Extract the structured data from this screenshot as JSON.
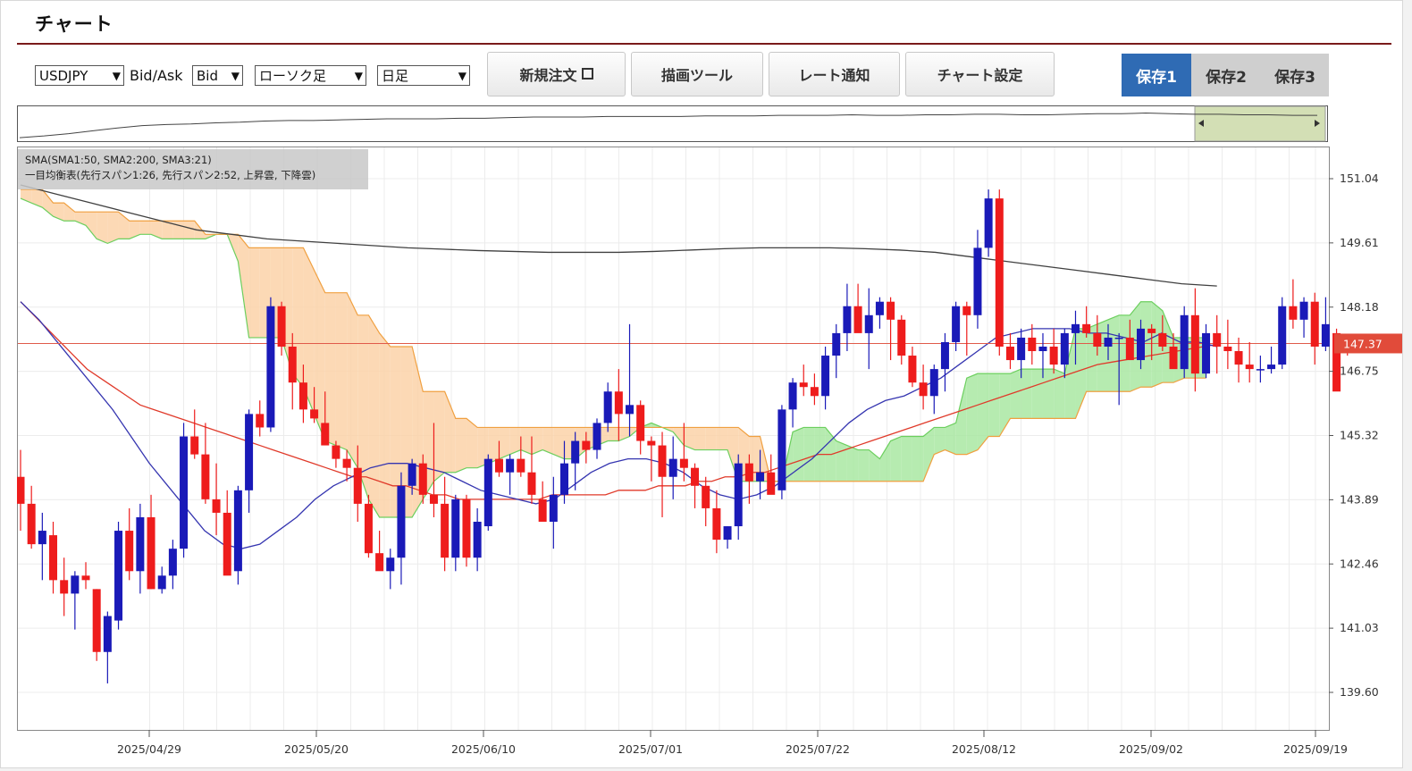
{
  "page": {
    "title": "チャート"
  },
  "toolbar": {
    "symbol": "USDJPY",
    "bidask_label": "Bid/Ask",
    "bidask_value": "Bid",
    "chart_type": "ローソク足",
    "period": "日足",
    "new_order": "新規注文",
    "drawing_tools": "描画ツール",
    "rate_alert": "レート通知",
    "chart_settings": "チャート設定",
    "saves": [
      "保存1",
      "保存2",
      "保存3"
    ],
    "active_save": 0
  },
  "colors": {
    "up": "#1a1ab8",
    "down": "#ee1c1c",
    "sma50": "#e03a2a",
    "sma200": "#404040",
    "sma21": "#3535b0",
    "cloud_up": "#a9e7a2",
    "cloud_down": "#fcd2a8",
    "span1": "#6ccf5e",
    "span2": "#f0a040",
    "price_line": "#e05a4a",
    "price_badge": "#e14b3a",
    "active_save": "#2f6bb4"
  },
  "chart_data": {
    "type": "candlestick",
    "symbol": "USDJPY",
    "timeframe": "日足",
    "legend": [
      "SMA(SMA1:50, SMA2:200, SMA3:21)",
      "一目均衡表(先行スパン1:26, 先行スパン2:52, 上昇雲, 下降雲)"
    ],
    "y_ticks": [
      "151.04",
      "149.61",
      "148.18",
      "146.75",
      "145.32",
      "143.89",
      "142.46",
      "141.03",
      "139.60"
    ],
    "ylim": [
      139.1,
      151.8
    ],
    "x_ticks": [
      "2025/04/29",
      "2025/05/20",
      "2025/06/10",
      "2025/07/01",
      "2025/07/22",
      "2025/08/12",
      "2025/09/02",
      "2025/09/19"
    ],
    "current_price": "147.37",
    "candles": [
      [
        144.4,
        145.0,
        143.2,
        143.8
      ],
      [
        143.8,
        144.2,
        142.8,
        142.9
      ],
      [
        142.9,
        143.6,
        142.1,
        143.2
      ],
      [
        143.1,
        143.4,
        141.8,
        142.1
      ],
      [
        142.1,
        142.6,
        141.3,
        141.8
      ],
      [
        141.8,
        142.3,
        141.0,
        142.2
      ],
      [
        142.2,
        142.5,
        141.9,
        142.1
      ],
      [
        141.9,
        141.9,
        140.3,
        140.5
      ],
      [
        140.5,
        141.4,
        139.8,
        141.3
      ],
      [
        141.2,
        143.4,
        141.0,
        143.2
      ],
      [
        143.2,
        143.7,
        142.1,
        142.3
      ],
      [
        142.3,
        143.8,
        141.8,
        143.5
      ],
      [
        143.5,
        144.0,
        141.9,
        141.9
      ],
      [
        141.9,
        142.4,
        141.8,
        142.2
      ],
      [
        142.2,
        143.0,
        141.9,
        142.8
      ],
      [
        142.8,
        145.6,
        142.6,
        145.3
      ],
      [
        145.3,
        145.9,
        144.8,
        144.9
      ],
      [
        144.9,
        145.6,
        143.8,
        143.9
      ],
      [
        143.9,
        144.7,
        143.1,
        143.6
      ],
      [
        143.6,
        144.1,
        142.3,
        142.2
      ],
      [
        142.3,
        144.2,
        142.0,
        144.1
      ],
      [
        144.1,
        145.9,
        143.6,
        145.8
      ],
      [
        145.8,
        146.1,
        145.3,
        145.5
      ],
      [
        145.5,
        148.4,
        145.4,
        148.2
      ],
      [
        148.2,
        148.3,
        147.1,
        147.3
      ],
      [
        147.3,
        147.6,
        145.9,
        146.5
      ],
      [
        146.5,
        146.9,
        145.6,
        145.9
      ],
      [
        145.9,
        146.4,
        145.6,
        145.7
      ],
      [
        145.6,
        146.3,
        145.3,
        145.1
      ],
      [
        145.1,
        145.2,
        144.6,
        144.8
      ],
      [
        144.8,
        145.0,
        144.3,
        144.6
      ],
      [
        144.6,
        145.1,
        143.4,
        143.8
      ],
      [
        143.8,
        144.0,
        142.6,
        142.7
      ],
      [
        142.7,
        143.2,
        142.4,
        142.3
      ],
      [
        142.3,
        142.8,
        141.9,
        142.6
      ],
      [
        142.6,
        144.5,
        142.0,
        144.2
      ],
      [
        144.2,
        144.8,
        144.0,
        144.7
      ],
      [
        144.7,
        144.9,
        143.8,
        144.0
      ],
      [
        144.0,
        145.6,
        143.5,
        143.8
      ],
      [
        143.8,
        144.4,
        142.3,
        142.6
      ],
      [
        142.6,
        144.0,
        142.3,
        143.9
      ],
      [
        143.9,
        144.0,
        142.4,
        142.6
      ],
      [
        142.6,
        143.7,
        142.3,
        143.4
      ],
      [
        143.3,
        144.9,
        143.2,
        144.8
      ],
      [
        144.8,
        145.2,
        144.4,
        144.5
      ],
      [
        144.5,
        144.9,
        144.0,
        144.8
      ],
      [
        144.8,
        145.3,
        144.4,
        144.5
      ],
      [
        144.5,
        145.3,
        143.8,
        144.0
      ],
      [
        143.9,
        144.3,
        143.5,
        143.4
      ],
      [
        143.4,
        144.4,
        142.8,
        144.0
      ],
      [
        144.0,
        145.2,
        143.8,
        144.7
      ],
      [
        144.7,
        145.4,
        144.1,
        145.2
      ],
      [
        145.2,
        145.4,
        144.7,
        145.0
      ],
      [
        145.0,
        145.7,
        144.8,
        145.6
      ],
      [
        145.6,
        146.5,
        145.4,
        146.3
      ],
      [
        146.3,
        146.8,
        145.2,
        145.8
      ],
      [
        145.8,
        147.8,
        145.3,
        146.0
      ],
      [
        146.0,
        146.1,
        144.9,
        145.2
      ],
      [
        145.2,
        145.3,
        144.3,
        145.1
      ],
      [
        145.1,
        145.4,
        143.5,
        144.4
      ],
      [
        144.4,
        145.3,
        143.9,
        144.8
      ],
      [
        144.8,
        145.6,
        144.3,
        144.6
      ],
      [
        144.6,
        144.7,
        143.7,
        144.2
      ],
      [
        144.2,
        144.4,
        143.3,
        143.7
      ],
      [
        143.7,
        144.1,
        142.7,
        143.0
      ],
      [
        143.0,
        143.3,
        142.8,
        143.3
      ],
      [
        143.3,
        144.9,
        143.0,
        144.7
      ],
      [
        144.7,
        144.9,
        143.8,
        144.3
      ],
      [
        144.3,
        145.0,
        143.9,
        144.5
      ],
      [
        144.5,
        144.9,
        144.1,
        144.0
      ],
      [
        144.1,
        146.0,
        143.9,
        145.9
      ],
      [
        145.9,
        146.6,
        145.5,
        146.5
      ],
      [
        146.5,
        146.9,
        146.2,
        146.4
      ],
      [
        146.4,
        146.7,
        146.0,
        146.2
      ],
      [
        146.2,
        147.3,
        145.9,
        147.1
      ],
      [
        147.1,
        147.8,
        146.6,
        147.6
      ],
      [
        147.6,
        148.7,
        147.2,
        148.2
      ],
      [
        148.2,
        148.7,
        147.8,
        147.6
      ],
      [
        147.6,
        148.6,
        146.8,
        148.0
      ],
      [
        148.0,
        148.4,
        147.7,
        148.3
      ],
      [
        148.3,
        148.4,
        147.0,
        147.9
      ],
      [
        147.9,
        148.0,
        146.9,
        147.1
      ],
      [
        147.1,
        147.3,
        146.4,
        146.5
      ],
      [
        146.5,
        146.9,
        145.9,
        146.2
      ],
      [
        146.2,
        146.9,
        145.8,
        146.8
      ],
      [
        146.8,
        147.6,
        146.3,
        147.4
      ],
      [
        147.4,
        148.3,
        147.2,
        148.2
      ],
      [
        148.2,
        148.3,
        147.1,
        148.0
      ],
      [
        148.0,
        149.9,
        147.7,
        149.5
      ],
      [
        149.5,
        150.8,
        149.3,
        150.6
      ],
      [
        150.6,
        150.8,
        147.1,
        147.3
      ],
      [
        147.3,
        147.6,
        146.8,
        147.0
      ],
      [
        147.0,
        147.7,
        146.6,
        147.5
      ],
      [
        147.5,
        147.8,
        146.9,
        147.2
      ],
      [
        147.2,
        147.6,
        146.6,
        147.3
      ],
      [
        147.3,
        147.7,
        146.7,
        146.9
      ],
      [
        146.9,
        147.7,
        146.6,
        147.6
      ],
      [
        147.6,
        148.1,
        146.9,
        147.8
      ],
      [
        147.8,
        148.2,
        147.5,
        147.6
      ],
      [
        147.6,
        148.0,
        147.1,
        147.3
      ],
      [
        147.3,
        147.8,
        147.0,
        147.5
      ],
      [
        147.5,
        147.6,
        146.0,
        147.5
      ],
      [
        147.5,
        147.9,
        147.0,
        147.0
      ],
      [
        147.0,
        147.9,
        146.8,
        147.7
      ],
      [
        147.7,
        147.8,
        147.0,
        147.6
      ],
      [
        147.6,
        148.0,
        147.2,
        147.3
      ],
      [
        147.3,
        147.6,
        146.9,
        146.8
      ],
      [
        146.8,
        148.2,
        146.6,
        148.0
      ],
      [
        148.0,
        148.6,
        146.3,
        146.7
      ],
      [
        146.7,
        147.8,
        146.6,
        147.6
      ],
      [
        147.6,
        148.0,
        146.7,
        147.3
      ],
      [
        147.3,
        147.9,
        146.8,
        147.2
      ],
      [
        147.2,
        147.5,
        146.5,
        146.9
      ],
      [
        146.9,
        147.4,
        146.5,
        146.8
      ],
      [
        146.8,
        147.1,
        146.5,
        146.8
      ],
      [
        146.8,
        147.3,
        146.7,
        146.9
      ],
      [
        146.9,
        148.4,
        146.8,
        148.2
      ],
      [
        148.2,
        148.8,
        147.7,
        147.9
      ],
      [
        147.9,
        148.4,
        147.5,
        148.3
      ],
      [
        148.3,
        148.5,
        146.9,
        147.3
      ],
      [
        147.3,
        148.4,
        147.2,
        147.8
      ],
      [
        147.6,
        147.7,
        146.5,
        146.3
      ],
      [
        147.4,
        147.5,
        147.1,
        147.3
      ]
    ],
    "sma50": [
      148.3,
      148.0,
      147.7,
      147.4,
      147.1,
      146.8,
      146.6,
      146.4,
      146.2,
      146.0,
      145.9,
      145.8,
      145.7,
      145.6,
      145.5,
      145.4,
      145.3,
      145.2,
      145.1,
      145.0,
      144.9,
      144.8,
      144.7,
      144.6,
      144.5,
      144.4,
      144.4,
      144.3,
      144.2,
      144.2,
      144.1,
      144.0,
      144.0,
      143.9,
      143.9,
      143.9,
      143.9,
      143.9,
      143.9,
      143.9,
      144.0,
      144.0,
      144.0,
      144.0,
      144.0,
      144.1,
      144.1,
      144.1,
      144.2,
      144.2,
      144.2,
      144.3,
      144.3,
      144.4,
      144.4,
      144.5,
      144.5,
      144.6,
      144.7,
      144.8,
      144.9,
      144.9,
      145.0,
      145.1,
      145.2,
      145.3,
      145.4,
      145.5,
      145.6,
      145.7,
      145.8,
      145.9,
      146.0,
      146.1,
      146.2,
      146.3,
      146.4,
      146.5,
      146.6,
      146.7,
      146.8,
      146.9,
      146.95,
      147.0,
      147.05,
      147.1,
      147.15,
      147.2,
      147.25,
      147.3,
      147.35
    ],
    "sma200": [
      150.9,
      150.7,
      150.5,
      150.3,
      150.1,
      149.9,
      149.8,
      149.7,
      149.65,
      149.6,
      149.55,
      149.5,
      149.47,
      149.44,
      149.42,
      149.4,
      149.4,
      149.4,
      149.42,
      149.45,
      149.48,
      149.5,
      149.5,
      149.5,
      149.48,
      149.45,
      149.4,
      149.3,
      149.2,
      149.1,
      149.0,
      148.9,
      148.8,
      148.7,
      148.65
    ],
    "sma21": [
      148.3,
      147.9,
      147.4,
      146.9,
      146.4,
      145.9,
      145.3,
      144.7,
      144.2,
      143.7,
      143.2,
      142.9,
      142.8,
      142.9,
      143.2,
      143.5,
      143.9,
      144.2,
      144.4,
      144.6,
      144.7,
      144.7,
      144.6,
      144.5,
      144.3,
      144.1,
      144.0,
      143.9,
      143.8,
      143.9,
      144.2,
      144.5,
      144.7,
      144.8,
      144.8,
      144.7,
      144.5,
      144.2,
      144.0,
      143.9,
      144.0,
      144.2,
      144.5,
      144.8,
      145.2,
      145.6,
      145.9,
      146.1,
      146.2,
      146.4,
      146.6,
      146.9,
      147.2,
      147.5,
      147.6,
      147.7,
      147.7,
      147.7,
      147.6,
      147.6,
      147.5,
      147.4,
      147.6,
      147.4,
      147.4,
      147.3
    ],
    "senkou_span1": [
      150.6,
      150.5,
      150.4,
      150.2,
      150.1,
      150.1,
      150.0,
      149.7,
      149.6,
      149.7,
      149.7,
      149.8,
      149.8,
      149.7,
      149.7,
      149.7,
      149.7,
      149.7,
      149.8,
      149.8,
      149.2,
      147.5,
      147.5,
      147.5,
      147.5,
      146.7,
      146.4,
      145.8,
      145.2,
      145.1,
      145.0,
      144.6,
      143.9,
      143.5,
      143.5,
      143.5,
      143.5,
      143.9,
      144.3,
      144.5,
      144.5,
      144.6,
      144.6,
      144.7,
      144.8,
      144.9,
      145.0,
      144.9,
      145.0,
      144.9,
      144.8,
      144.8,
      145.0,
      145.1,
      145.2,
      145.2,
      145.3,
      145.5,
      145.6,
      145.5,
      145.4,
      145.1,
      145.0,
      145.0,
      145.0,
      145.0,
      144.3,
      144.3,
      144.3,
      144.3,
      144.3,
      145.4,
      145.5,
      145.5,
      145.5,
      145.2,
      145.1,
      145.0,
      145.0,
      144.8,
      145.2,
      145.3,
      145.3,
      145.3,
      145.5,
      145.5,
      145.6,
      146.6,
      146.7,
      146.7,
      146.7,
      146.7,
      146.8,
      146.8,
      146.8,
      146.8,
      146.7,
      147.7,
      147.7,
      147.8,
      147.9,
      148.0,
      148.0,
      148.3,
      148.3,
      148.1,
      147.5,
      147.5,
      147.5,
      147.5
    ],
    "senkou_span2": [
      150.8,
      150.8,
      150.8,
      150.5,
      150.5,
      150.3,
      150.3,
      150.3,
      150.3,
      150.3,
      150.1,
      150.1,
      150.1,
      150.1,
      150.1,
      150.1,
      150.1,
      149.8,
      149.8,
      149.8,
      149.8,
      149.5,
      149.5,
      149.5,
      149.5,
      149.5,
      149.5,
      149.0,
      148.5,
      148.5,
      148.5,
      148.0,
      148.0,
      147.6,
      147.3,
      147.3,
      147.3,
      146.3,
      146.3,
      146.3,
      145.7,
      145.7,
      145.5,
      145.5,
      145.5,
      145.5,
      145.5,
      145.5,
      145.5,
      145.5,
      145.5,
      145.5,
      145.5,
      145.5,
      145.5,
      145.5,
      145.5,
      145.5,
      145.5,
      145.5,
      145.5,
      145.5,
      145.5,
      145.5,
      145.5,
      145.5,
      145.5,
      145.3,
      145.3,
      144.3,
      144.3,
      144.3,
      144.3,
      144.3,
      144.3,
      144.3,
      144.3,
      144.3,
      144.3,
      144.3,
      144.3,
      144.3,
      144.3,
      144.3,
      144.9,
      145.0,
      144.9,
      144.9,
      145.0,
      145.3,
      145.3,
      145.7,
      145.7,
      145.7,
      145.7,
      145.7,
      145.7,
      145.7,
      146.3,
      146.3,
      146.3,
      146.3,
      146.3,
      146.4,
      146.4,
      146.5,
      146.5,
      146.6,
      146.6,
      146.6
    ]
  }
}
